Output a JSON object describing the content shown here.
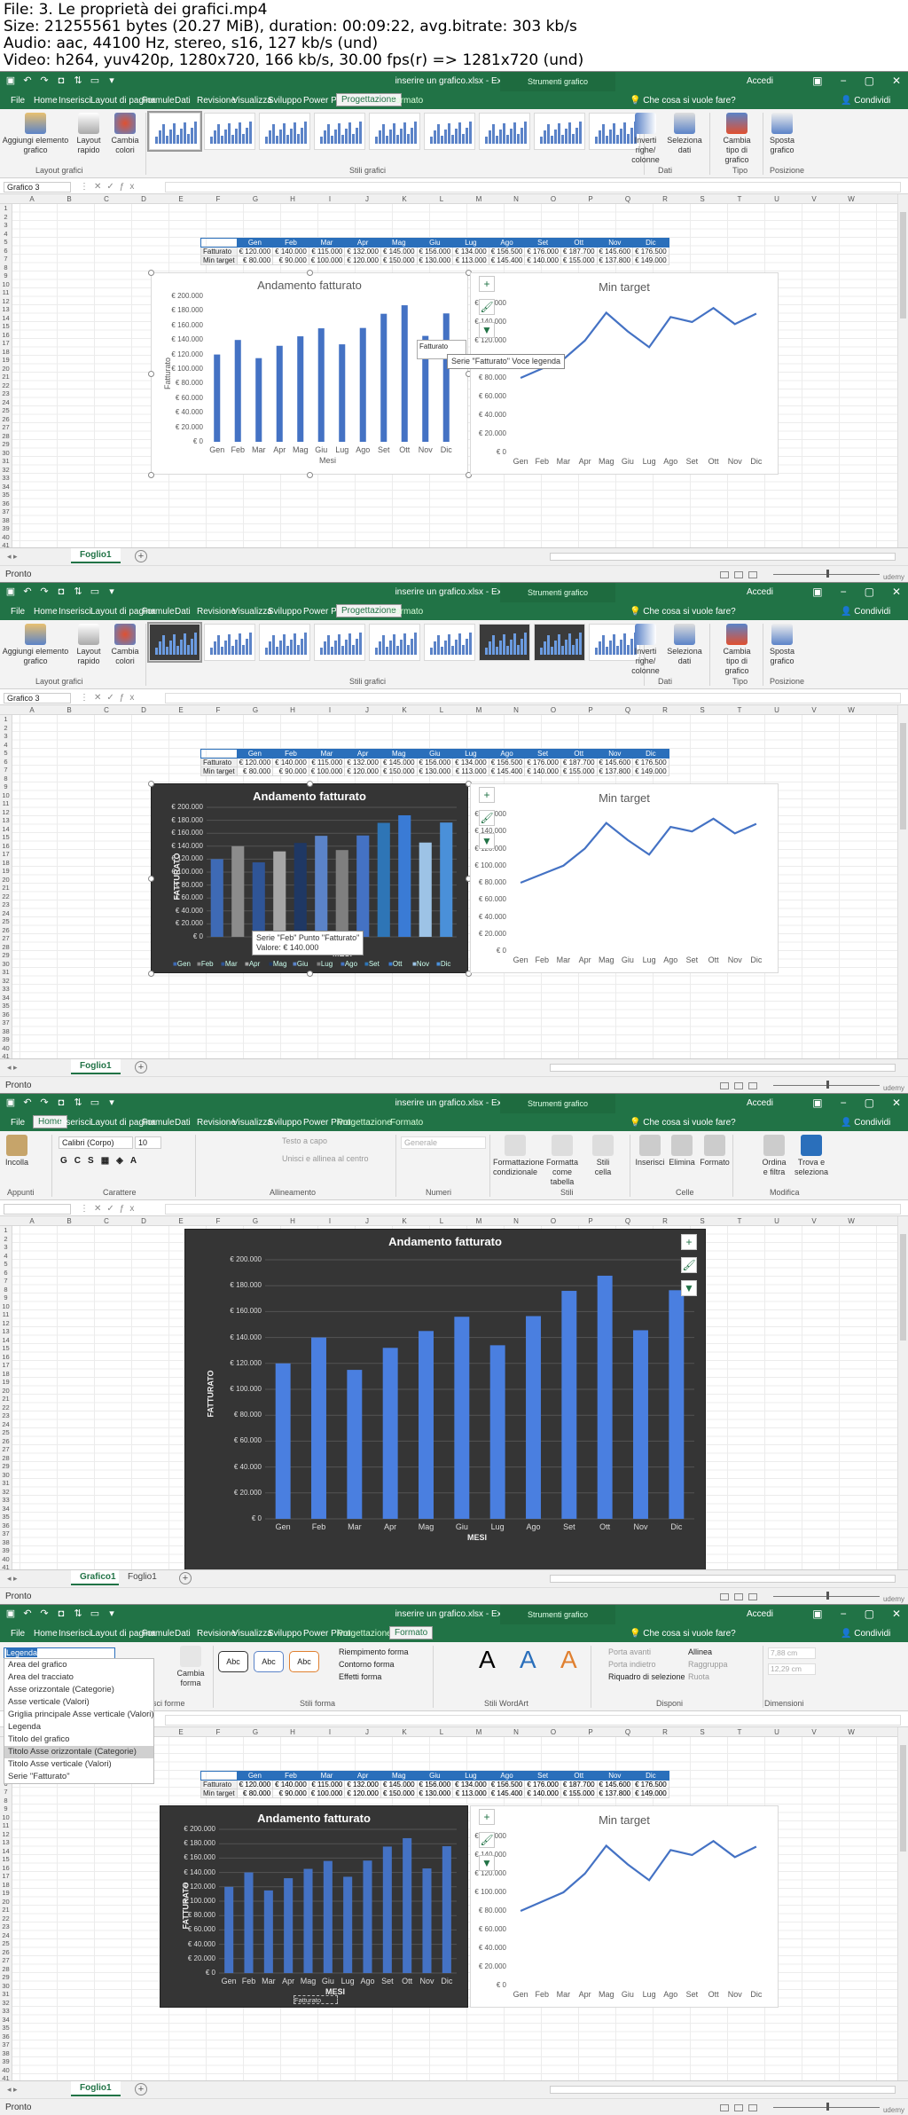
{
  "header": {
    "line1": "File: 3. Le proprietà dei grafici.mp4",
    "line2": "Size: 21255561 bytes (20.27 MiB), duration: 00:09:22, avg.bitrate: 303 kb/s",
    "line3": "Audio: aac, 44100 Hz, stereo, s16, 127 kb/s (und)",
    "line4": "Video: h264, yuv420p, 1280x720, 166 kb/s, 30.00 fps(r) => 1281x720 (und)"
  },
  "window": {
    "title": "inserire un grafico.xlsx - Excel",
    "context_tools": "Strumenti grafico",
    "account": "Accedi",
    "tell_me": "Che cosa si vuole fare?",
    "share": "Condividi",
    "status": "Pronto"
  },
  "tabs": [
    "File",
    "Home",
    "Inserisci",
    "Layout di pagina",
    "Formule",
    "Dati",
    "Revisione",
    "Visualizza",
    "Sviluppo",
    "Power Pivot",
    "Progettazione",
    "Formato"
  ],
  "ribbon_design": {
    "add_element": "Aggiungi elemento grafico",
    "quick_layout": "Layout rapido",
    "change_colors": "Cambia colori",
    "switch": "Inverti righe/ colonne",
    "select_data": "Seleziona dati",
    "change_type": "Cambia tipo di grafico",
    "move": "Sposta grafico",
    "groups": [
      "Layout grafici",
      "Stili grafici",
      "Dati",
      "Tipo",
      "Posizione"
    ]
  },
  "ribbon_home": {
    "paste": "Incolla",
    "font": "Calibri (Corpo)",
    "size": "10",
    "wrap": "Testo a capo",
    "merge": "Unisci e allinea al centro",
    "number": "Generale",
    "cond_format": "Formattazione condizionale",
    "as_table": "Formatta come tabella",
    "cell_styles": "Stili cella",
    "insert": "Inserisci",
    "delete": "Elimina",
    "format": "Formato",
    "sort": "Ordina e filtra",
    "find": "Trova e seleziona",
    "groups": [
      "Appunti",
      "Carattere",
      "Allineamento",
      "Numeri",
      "Stili",
      "Celle",
      "Modifica"
    ]
  },
  "ribbon_format": {
    "fill": "Riempimento forma",
    "outline": "Contorno forma",
    "effects": "Effetti forma",
    "bring_forward": "Porta avanti",
    "send_back": "Porta indietro",
    "selection_pane": "Riquadro di selezione",
    "align": "Allinea",
    "group": "Raggruppa",
    "rotate": "Ruota",
    "height": "7,88 cm",
    "width": "12,29 cm",
    "change_shape": "Cambia forma",
    "shape_label": "Abc",
    "wordart_label": "A",
    "groups": [
      "Inserisci forme",
      "Stili forma",
      "Stili WordArt",
      "Disponi",
      "Dimensioni"
    ]
  },
  "namebox": [
    "Grafico 3",
    "Grafico 3",
    "",
    "Legenda"
  ],
  "columns": [
    "A",
    "B",
    "C",
    "D",
    "E",
    "F",
    "G",
    "H",
    "I",
    "J",
    "K",
    "L",
    "M",
    "N",
    "O",
    "P",
    "Q",
    "R",
    "S",
    "T",
    "U",
    "V",
    "W"
  ],
  "table": {
    "months": [
      "Gen",
      "Feb",
      "Mar",
      "Apr",
      "Mag",
      "Giu",
      "Lug",
      "Ago",
      "Set",
      "Ott",
      "Nov",
      "Dic"
    ],
    "row1_label": "Fatturato",
    "row2_label": "Min target",
    "fatturato": [
      "€ 120.000",
      "€ 140.000",
      "€ 115.000",
      "€ 132.000",
      "€ 145.000",
      "€ 156.000",
      "€ 134.000",
      "€ 156.500",
      "€ 176.000",
      "€ 187.700",
      "€ 145.600",
      "€ 176.500"
    ],
    "min_target": [
      "€ 80.000",
      "€ 90.000",
      "€ 100.000",
      "€ 120.000",
      "€ 150.000",
      "€ 130.000",
      "€ 113.000",
      "€ 145.400",
      "€ 140.000",
      "€ 155.000",
      "€ 137.800",
      "€ 149.000"
    ]
  },
  "chart_data": [
    {
      "type": "bar",
      "title": "Andamento fatturato",
      "xlabel": "Mesi",
      "ylabel": "Fatturato",
      "categories": [
        "Gen",
        "Feb",
        "Mar",
        "Apr",
        "Mag",
        "Giu",
        "Lug",
        "Ago",
        "Set",
        "Ott",
        "Nov",
        "Dic"
      ],
      "values": [
        120000,
        140000,
        115000,
        132000,
        145000,
        156000,
        134000,
        156500,
        176000,
        187700,
        145600,
        176500
      ],
      "ylim": [
        0,
        200000
      ],
      "yticks": [
        "€ 200.000",
        "€ 180.000",
        "€ 160.000",
        "€ 140.000",
        "€ 120.000",
        "€ 100.000",
        "€ 80.000",
        "€ 60.000",
        "€ 40.000",
        "€ 20.000",
        "€ 0"
      ]
    },
    {
      "type": "line",
      "title": "Min target",
      "categories": [
        "Gen",
        "Feb",
        "Mar",
        "Apr",
        "Mag",
        "Giu",
        "Lug",
        "Ago",
        "Set",
        "Ott",
        "Nov",
        "Dic"
      ],
      "values": [
        80000,
        90000,
        100000,
        120000,
        150000,
        130000,
        113000,
        145400,
        140000,
        155000,
        137800,
        149000
      ],
      "ylim": [
        0,
        160000
      ],
      "yticks": [
        "€ 160.000",
        "€ 140.000",
        "€ 120.000",
        "€ 100.000",
        "€ 80.000",
        "€ 60.000",
        "€ 40.000",
        "€ 20.000",
        "€ 0"
      ]
    }
  ],
  "dark_chart": {
    "title": "Andamento fatturato",
    "xlabel": "Fatturato",
    "xlabel2": "MESI",
    "ylabel": "FATTURATO",
    "legend": [
      "Gen",
      "Feb",
      "Mar",
      "Apr",
      "Mag",
      "Giu",
      "Lug",
      "Ago",
      "Set",
      "Ott",
      "Nov",
      "Dic"
    ]
  },
  "tooltips": {
    "legend_series": "Serie \"Fatturato\" Voce legenda",
    "legend_series_short": "Asse v",
    "point": "Serie \"Feb\" Punto \"Fatturato\"",
    "point_value": "Valore: € 140.000",
    "legend_item": "Fatturato"
  },
  "dropdown": [
    "Area del grafico",
    "Area del tracciato",
    "Asse orizzontale (Categorie)",
    "Asse verticale (Valori)",
    "Griglia principale Asse verticale (Valori)",
    "Legenda",
    "Titolo del grafico",
    "Titolo Asse orizzontale (Categorie)",
    "Titolo Asse verticale (Valori)",
    "Serie \"Fatturato\""
  ],
  "sheets": [
    "Foglio1",
    "Grafico1"
  ],
  "watermark": "udemy"
}
